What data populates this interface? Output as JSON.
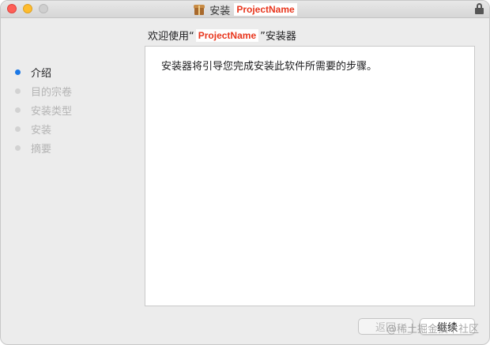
{
  "window": {
    "title_prefix": "安装",
    "title_highlight": "ProjectName"
  },
  "heading": {
    "prefix": "欢迎使用“",
    "name": "ProjectName",
    "suffix": "”安装器"
  },
  "sidebar": {
    "steps": [
      {
        "label": "介绍",
        "active": true
      },
      {
        "label": "目的宗卷",
        "active": false
      },
      {
        "label": "安装类型",
        "active": false
      },
      {
        "label": "安装",
        "active": false
      },
      {
        "label": "摘要",
        "active": false
      }
    ]
  },
  "content": {
    "text": "安装器将引导您完成安装此软件所需要的步骤。"
  },
  "buttons": {
    "back": "返回",
    "continue": "继续"
  },
  "watermark": "@稀土掘金技术社区",
  "colors": {
    "accent": "#1b78e6",
    "highlight_text": "#e8361d"
  },
  "icons": {
    "title": "package-icon",
    "lock": "lock-icon"
  }
}
